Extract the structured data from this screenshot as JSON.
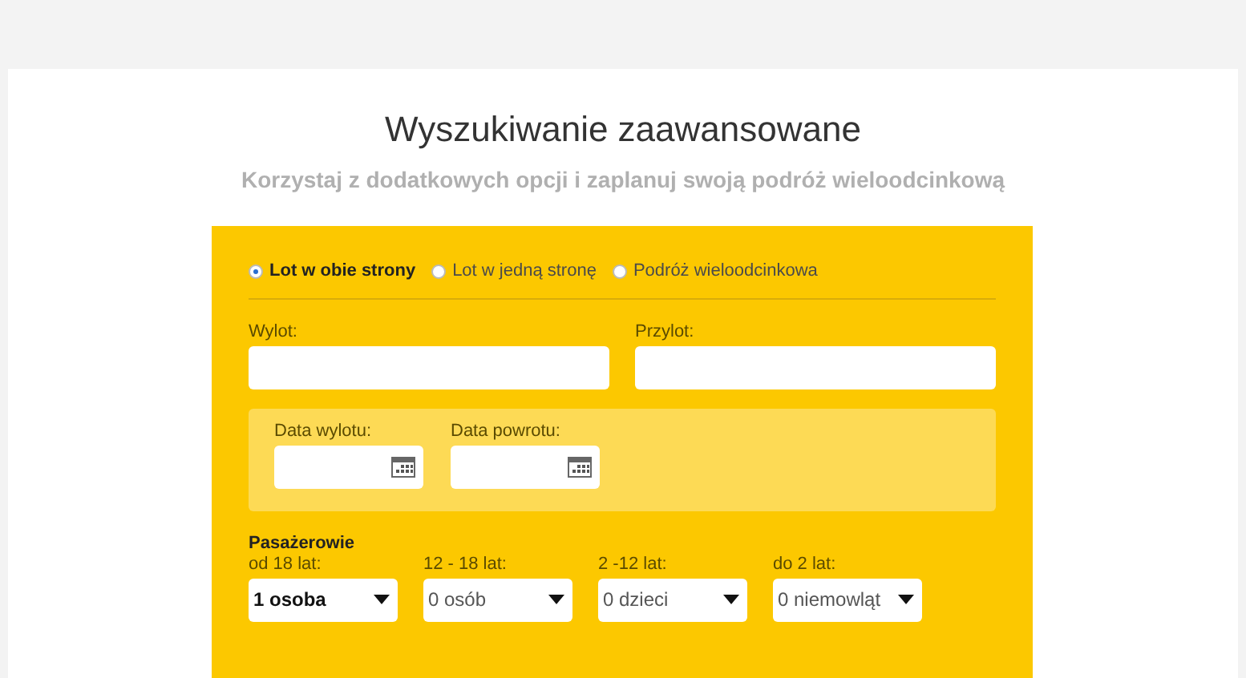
{
  "header": {
    "title": "Wyszukiwanie zaawansowane",
    "subtitle": "Korzystaj z dodatkowych opcji i zaplanuj swoją podróż wieloodcinkową"
  },
  "trip_types": [
    {
      "label": "Lot w obie strony",
      "selected": true
    },
    {
      "label": "Lot w jedną stronę",
      "selected": false
    },
    {
      "label": "Podróż wieloodcinkowa",
      "selected": false
    }
  ],
  "airports": [
    {
      "label": "Wylot:"
    },
    {
      "label": "Przylot:"
    }
  ],
  "dates": [
    {
      "label": "Data wylotu:"
    },
    {
      "label": "Data powrotu:"
    }
  ],
  "passengers": {
    "title": "Pasażerowie",
    "groups": [
      {
        "label": "od 18 lat:",
        "value": "1 osoba",
        "filled": true
      },
      {
        "label": "12 - 18 lat:",
        "value": "0 osób",
        "filled": false
      },
      {
        "label": "2 -12 lat:",
        "value": "0 dzieci",
        "filled": false
      },
      {
        "label": "do 2 lat:",
        "value": "0 niemowląt",
        "filled": false
      }
    ]
  }
}
